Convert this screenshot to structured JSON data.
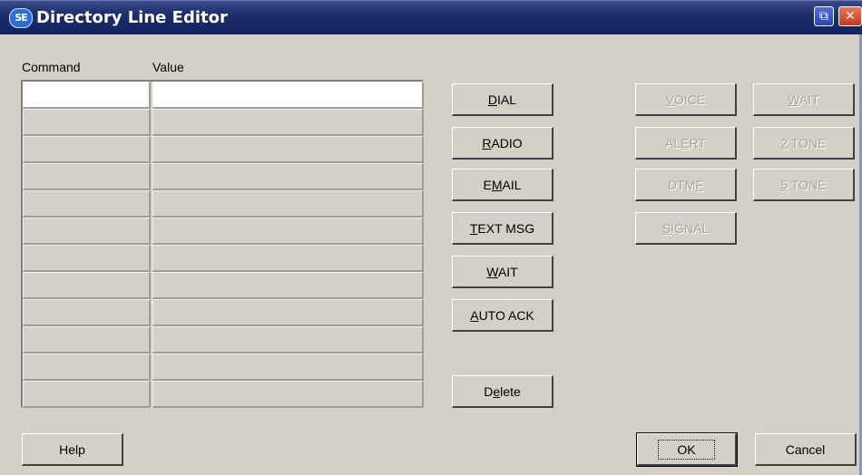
{
  "window": {
    "title": "Directory Line Editor",
    "icon_text": "SE",
    "restore_glyph": "⧉",
    "close_glyph": "✕"
  },
  "grid": {
    "columns": [
      "Command",
      "Value"
    ],
    "rows": [
      {
        "command": "",
        "value": ""
      },
      {
        "command": "",
        "value": ""
      },
      {
        "command": "",
        "value": ""
      },
      {
        "command": "",
        "value": ""
      },
      {
        "command": "",
        "value": ""
      },
      {
        "command": "",
        "value": ""
      },
      {
        "command": "",
        "value": ""
      },
      {
        "command": "",
        "value": ""
      },
      {
        "command": "",
        "value": ""
      },
      {
        "command": "",
        "value": ""
      },
      {
        "command": "",
        "value": ""
      },
      {
        "command": "",
        "value": ""
      }
    ]
  },
  "buttons": {
    "dial": {
      "pre": "",
      "u": "D",
      "post": "IAL"
    },
    "radio": {
      "pre": "",
      "u": "R",
      "post": "ADIO"
    },
    "email": {
      "pre": "E",
      "u": "M",
      "post": "AIL"
    },
    "text_msg": {
      "pre": "",
      "u": "T",
      "post": "EXT MSG"
    },
    "wait": {
      "pre": "",
      "u": "W",
      "post": "AIT"
    },
    "auto_ack": {
      "pre": "",
      "u": "A",
      "post": "UTO ACK"
    },
    "delete": {
      "pre": "D",
      "u": "e",
      "post": "lete"
    },
    "voice": {
      "pre": "",
      "u": "V",
      "post": "OICE"
    },
    "alert": {
      "pre": "AL",
      "u": "E",
      "post": "RT"
    },
    "dtmf": {
      "pre": "DTM",
      "u": "F",
      "post": ""
    },
    "signal": {
      "pre": "",
      "u": "S",
      "post": "IGNAL"
    },
    "wait2": {
      "pre": "",
      "u": "W",
      "post": "AIT"
    },
    "two_tone": {
      "pre": "",
      "u": "2",
      "post": " TONE"
    },
    "five_tone": {
      "pre": "",
      "u": "5",
      "post": " TONE"
    },
    "help": "Help",
    "ok": "OK",
    "cancel": "Cancel"
  }
}
